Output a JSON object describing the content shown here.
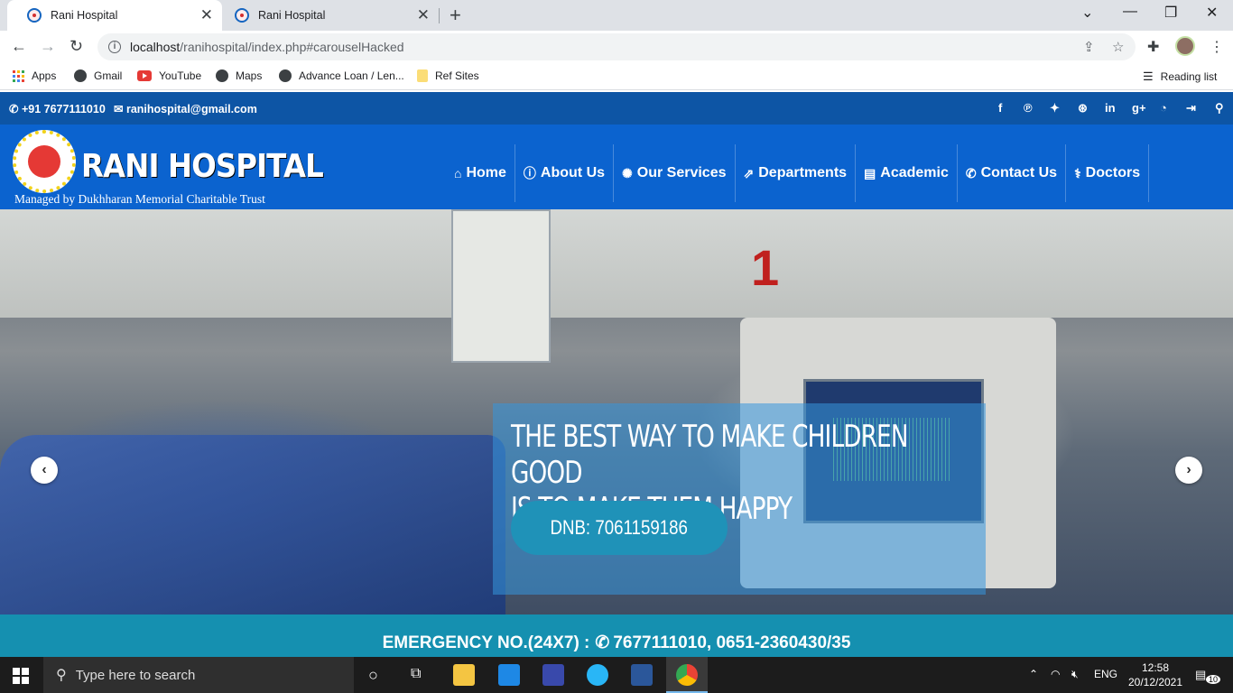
{
  "browser": {
    "tabs": [
      {
        "title": "Rani Hospital",
        "active": true
      },
      {
        "title": "Rani Hospital",
        "active": false
      }
    ],
    "new_tab_symbol": "+",
    "url_host": "localhost",
    "url_path": "/ranihospital/index.php#carouselHacked",
    "bookmarks": [
      "Apps",
      "Gmail",
      "YouTube",
      "Maps",
      "Advance Loan / Len...",
      "Ref Sites"
    ],
    "reading_list": "Reading list"
  },
  "site": {
    "phone": "+91 7677111010",
    "email": "ranihospital@gmail.com",
    "brand": "RANI HOSPITAL",
    "trust": "Managed by Dukhharan Memorial Charitable Trust",
    "nav": [
      {
        "label": "Home",
        "icon": "home-icon"
      },
      {
        "label": "About Us",
        "icon": "info-circle-icon"
      },
      {
        "label": "Our Services",
        "icon": "spinner-icon"
      },
      {
        "label": "Departments",
        "icon": "external-link-icon"
      },
      {
        "label": "Academic",
        "icon": "book-icon"
      },
      {
        "label": "Contact Us",
        "icon": "phone-icon"
      },
      {
        "label": "Doctors",
        "icon": "user-md-icon"
      }
    ],
    "social_icons": [
      "facebook-icon",
      "pinterest-icon",
      "twitter-icon",
      "dribbble-icon",
      "linkedin-icon",
      "google-plus-icon",
      "rss-icon",
      "sign-in-icon",
      "map-marker-icon"
    ],
    "carousel": {
      "line1": "THE BEST WAY TO MAKE CHILDREN GOOD",
      "line2": "IS TO MAKE THEM HAPPY",
      "button": "DNB: 7061159186",
      "sign": "1"
    },
    "emergency": "EMERGENCY NO.(24X7) :",
    "emergency_numbers": "7677111010, 0651-2360430/35"
  },
  "taskbar": {
    "search_placeholder": "Type here to search",
    "lang": "ENG",
    "time": "12:58",
    "date": "20/12/2021",
    "notifications": "10"
  },
  "colors": {
    "topbar": "#0d55a5",
    "header": "#0b63cf",
    "emergency": "#1590b0",
    "cta": "#1f92b8"
  }
}
